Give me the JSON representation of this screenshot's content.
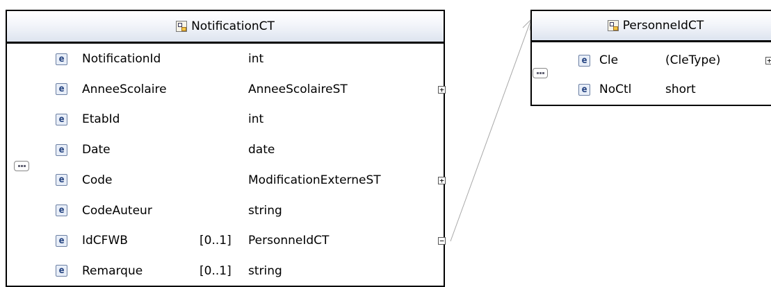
{
  "notification": {
    "title": "NotificationCT",
    "elements": [
      {
        "name": "NotificationId",
        "cardinality": "",
        "type": "int",
        "expander": ""
      },
      {
        "name": "AnneeScolaire",
        "cardinality": "",
        "type": "AnneeScolaireST",
        "expander": "+"
      },
      {
        "name": "EtabId",
        "cardinality": "",
        "type": "int",
        "expander": ""
      },
      {
        "name": "Date",
        "cardinality": "",
        "type": "date",
        "expander": ""
      },
      {
        "name": "Code",
        "cardinality": "",
        "type": "ModificationExterneST",
        "expander": "+"
      },
      {
        "name": "CodeAuteur",
        "cardinality": "",
        "type": "string",
        "expander": ""
      },
      {
        "name": "IdCFWB",
        "cardinality": "[0..1]",
        "type": "PersonneIdCT",
        "expander": "−"
      },
      {
        "name": "Remarque",
        "cardinality": "[0..1]",
        "type": "string",
        "expander": ""
      }
    ]
  },
  "personne": {
    "title": "PersonneIdCT",
    "elements": [
      {
        "name": "Cle",
        "cardinality": "",
        "type": "(CleType)",
        "expander": "+"
      },
      {
        "name": "NoCtl",
        "cardinality": "",
        "type": "short",
        "expander": ""
      }
    ]
  },
  "icons": {
    "element_letter": "e",
    "element_icon": "element-e-icon",
    "complex_type_icon": "complex-type-icon",
    "sequence_icon": "sequence-compositor-icon"
  },
  "colors": {
    "header_gradient_top": "#ffffff",
    "header_gradient_bottom": "#dde4ef",
    "connector": "#a8a8a8",
    "icon_border": "#6b7fa3"
  }
}
